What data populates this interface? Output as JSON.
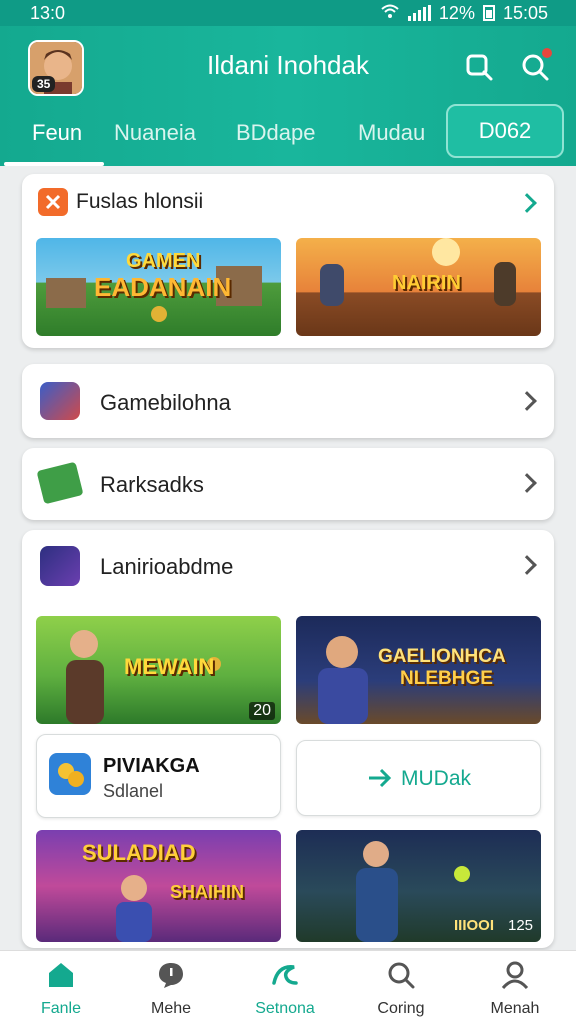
{
  "status_bar": {
    "time": "13:0",
    "battery": "12%",
    "clock_right": "15:05"
  },
  "header": {
    "app_title": "Ildani Inohdak",
    "avatar_level": "35",
    "tabs": [
      {
        "label": "Feun",
        "active": true
      },
      {
        "label": "Nuaneia",
        "active": false
      },
      {
        "label": "BDdape",
        "active": false
      },
      {
        "label": "Mudau",
        "active": false
      }
    ],
    "boxed_tab": "D062"
  },
  "sections": {
    "featured": {
      "title": "Fuslas hlonsii",
      "games": [
        {
          "title_line1": "GAMEN",
          "title_line2": "EADANAIN"
        },
        {
          "title_line1": "NAIRIN"
        }
      ]
    },
    "row1": {
      "title": "Gamebilohna"
    },
    "row2": {
      "title": "Rarksadks"
    },
    "row3": {
      "title": "Lanirioabdme",
      "banner_left": {
        "title": "MEWAIN",
        "badge": "20"
      },
      "banner_right": {
        "title_line1": "GAELIONHCA",
        "title_line2": "NLEBHGE"
      },
      "mini_card": {
        "title": "PIVIAKGA",
        "subtitle": "Sdlanel"
      },
      "action_card": {
        "label": "MUDak"
      },
      "banner_bottom_left": {
        "title_line1": "SULADIAD",
        "title_line2": "SHAIHIN"
      },
      "banner_bottom_right": {
        "badge_a": "IIIOOI",
        "badge_b": "125"
      }
    }
  },
  "bottom_nav": [
    {
      "label": "Fanle",
      "icon": "home-icon",
      "active": true
    },
    {
      "label": "Mehe",
      "icon": "chat-bubble-icon",
      "active": false
    },
    {
      "label": "Setnona",
      "icon": "swirl-logo-icon",
      "active": false
    },
    {
      "label": "Coring",
      "icon": "search-icon",
      "active": false
    },
    {
      "label": "Menah",
      "icon": "person-icon",
      "active": false
    }
  ],
  "colors": {
    "accent": "#14a98f",
    "notification": "#e7473c"
  }
}
